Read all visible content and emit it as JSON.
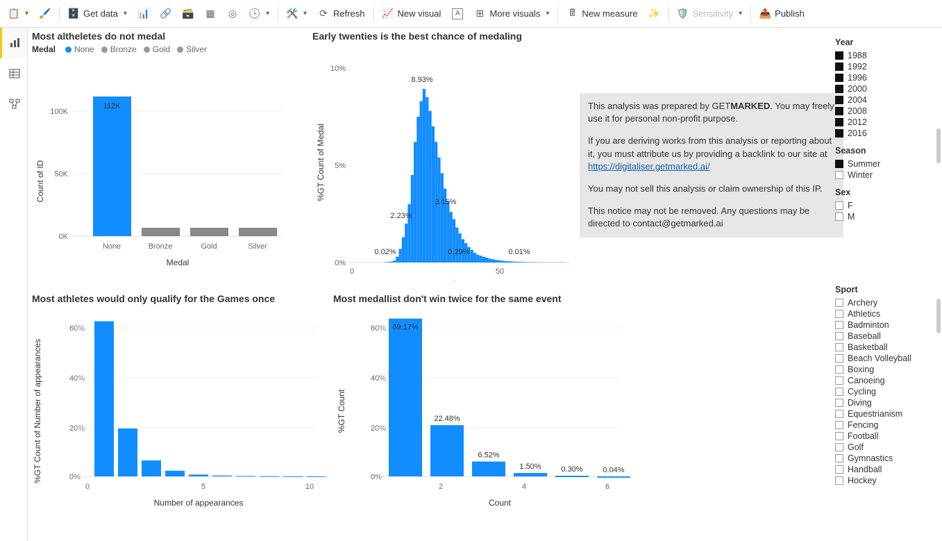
{
  "toolbar": {
    "paste": "Paste",
    "get_data": "Get data",
    "refresh": "Refresh",
    "new_visual": "New visual",
    "more_visuals": "More visuals",
    "new_measure": "New measure",
    "sensitivity": "Sensitivity",
    "publish": "Publish"
  },
  "chart1": {
    "title": "Most altheletes do not medal",
    "legend_title": "Medal",
    "legend": [
      {
        "label": "None",
        "color": "#118DFF"
      },
      {
        "label": "Bronze",
        "color": "#999"
      },
      {
        "label": "Gold",
        "color": "#999"
      },
      {
        "label": "Silver",
        "color": "#999"
      }
    ],
    "ylabel": "Count of ID",
    "xlabel": "Medal",
    "value_label": "112K"
  },
  "chart2": {
    "title": "Early twenties is the best chance of medaling",
    "ylabel": "%GT Count of Medal",
    "xlabel": "Age",
    "peak_label": "8.93%"
  },
  "chart3": {
    "title": "Most athletes would only qualify for the Games once",
    "ylabel": "%GT Count of Number of appearances",
    "xlabel": "Number of appearances"
  },
  "chart4": {
    "title": "Most medallist don't win twice for the same event",
    "ylabel": "%GT Count",
    "xlabel": "Count"
  },
  "info": {
    "line1a": "This analysis was prepared by GET",
    "line1b": "MARKED",
    "line1c": ". You may freely use it for personal non-profit purpose.",
    "line2": "If you are deriving works from this analysis or reporting about it, you must attribute us by providing a backlink to our site at ",
    "url": "https://digitaliser.getmarked.ai/",
    "line3": "You may not sell this analysis or claim ownership of this IP.",
    "line4": "This notice may not be removed. Any questions may be directed to contact@getmarked.ai"
  },
  "filters": {
    "year_title": "Year",
    "years": [
      "1988",
      "1992",
      "1996",
      "2000",
      "2004",
      "2008",
      "2012",
      "2016"
    ],
    "season_title": "Season",
    "seasons": [
      {
        "label": "Summer",
        "checked": true
      },
      {
        "label": "Winter",
        "checked": false
      }
    ],
    "sex_title": "Sex",
    "sexes": [
      "F",
      "M"
    ],
    "sport_title": "Sport",
    "sports": [
      "Archery",
      "Athletics",
      "Badminton",
      "Baseball",
      "Basketball",
      "Beach Volleyball",
      "Boxing",
      "Canoeing",
      "Cycling",
      "Diving",
      "Equestrianism",
      "Fencing",
      "Football",
      "Golf",
      "Gymnastics",
      "Handball",
      "Hockey"
    ]
  },
  "chart_data": [
    {
      "id": "chart1",
      "type": "bar",
      "title": "Most altheletes do not medal",
      "xlabel": "Medal",
      "ylabel": "Count of ID",
      "categories": [
        "None",
        "Bronze",
        "Gold",
        "Silver"
      ],
      "values": [
        112000,
        6500,
        6500,
        6500
      ],
      "ylim": [
        0,
        120000
      ]
    },
    {
      "id": "chart2",
      "type": "bar",
      "title": "Early twenties is the best chance of medaling",
      "xlabel": "Age",
      "ylabel": "%GT Count of Medal",
      "x": [
        10,
        11,
        12,
        13,
        14,
        15,
        16,
        17,
        18,
        19,
        20,
        21,
        22,
        23,
        24,
        25,
        26,
        27,
        28,
        29,
        30,
        31,
        32,
        33,
        34,
        35,
        36,
        37,
        38,
        39,
        40,
        41,
        42,
        43,
        44,
        45,
        46,
        47,
        48,
        49,
        50,
        51,
        52,
        53,
        54,
        55,
        56,
        57,
        58,
        59,
        60,
        61,
        62,
        63,
        64,
        65,
        66,
        67,
        68,
        69,
        70
      ],
      "values": [
        0.02,
        0.03,
        0.05,
        0.1,
        0.3,
        0.7,
        1.3,
        2.0,
        3.0,
        4.5,
        6.2,
        7.5,
        8.3,
        8.93,
        8.5,
        7.8,
        7.0,
        6.2,
        5.4,
        4.6,
        3.8,
        3.15,
        2.6,
        2.23,
        1.8,
        1.5,
        1.2,
        1.0,
        0.8,
        0.65,
        0.5,
        0.4,
        0.35,
        0.29,
        0.25,
        0.2,
        0.17,
        0.14,
        0.12,
        0.1,
        0.08,
        0.07,
        0.06,
        0.05,
        0.04,
        0.035,
        0.03,
        0.025,
        0.02,
        0.018,
        0.015,
        0.013,
        0.012,
        0.011,
        0.01,
        0.01,
        0.01,
        0.01,
        0.01,
        0.01,
        0.01
      ],
      "annotations": [
        {
          "x": 23,
          "label": "8.93%"
        },
        {
          "x": 31,
          "label": "3.15%"
        },
        {
          "x": 33,
          "label": "2.23%"
        },
        {
          "x": 43,
          "label": "0.29%"
        },
        {
          "x": 10,
          "label": "0.02%"
        },
        {
          "x": 65,
          "label": "0.01%"
        }
      ],
      "ylim": [
        0,
        10
      ]
    },
    {
      "id": "chart3",
      "type": "bar",
      "title": "Most athletes would only qualify for the Games once",
      "xlabel": "Number of appearances",
      "ylabel": "%GT Count of Number of appearances",
      "categories": [
        1,
        2,
        3,
        4,
        5,
        6,
        7,
        8,
        9,
        10
      ],
      "values": [
        68,
        21,
        7,
        2.5,
        0.8,
        0.4,
        0.2,
        0.1,
        0.05,
        0.03
      ],
      "ylim": [
        0,
        70
      ]
    },
    {
      "id": "chart4",
      "type": "bar",
      "title": "Most medallist don't win twice for the same event",
      "xlabel": "Count",
      "ylabel": "%GT Count",
      "categories": [
        1,
        2,
        3,
        4,
        5,
        6
      ],
      "values": [
        69.17,
        22.48,
        6.52,
        1.5,
        0.3,
        0.04
      ],
      "value_labels": [
        "69.17%",
        "22.48%",
        "6.52%",
        "1.50%",
        "0.30%",
        "0.04%"
      ],
      "ylim": [
        0,
        70
      ]
    }
  ]
}
